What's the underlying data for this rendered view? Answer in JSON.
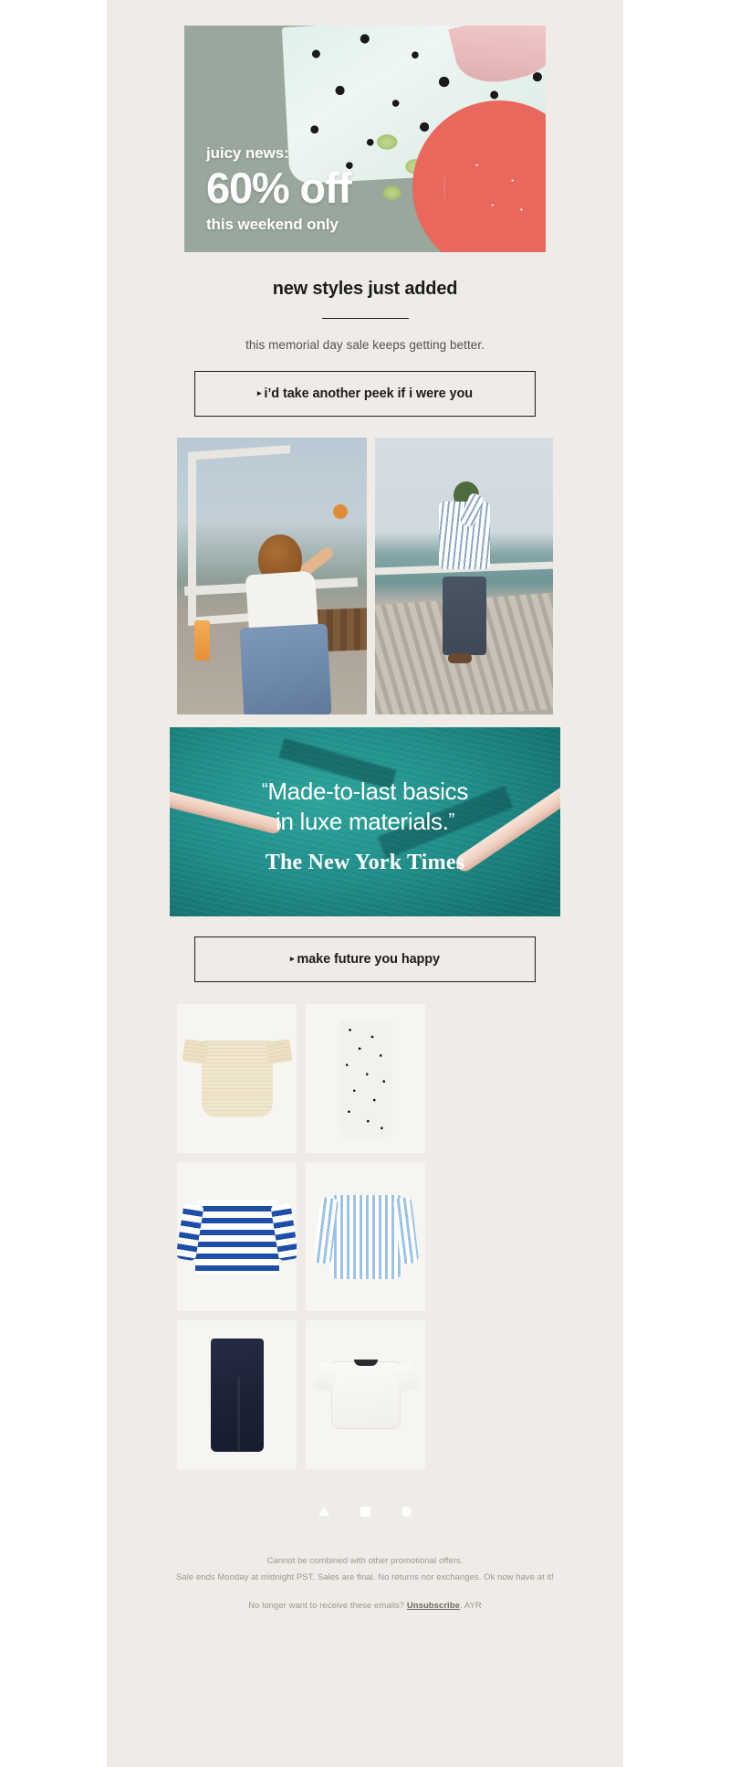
{
  "hero": {
    "eyebrow": "juicy news:",
    "headline": "60% off",
    "sub": "this weekend only",
    "alt": "watermelon-and-polka-dot-cloth-photo"
  },
  "intro": {
    "headline": "new styles just added",
    "subcopy": "this memorial day sale keeps getting better."
  },
  "cta_primary": {
    "marker": "▸",
    "label": "i’d take another peek if i were you"
  },
  "cta_secondary": {
    "marker": "▸",
    "label": "make future you happy"
  },
  "lifestyle": {
    "left_alt": "woman-in-white-shirt-and-jeans-at-beach",
    "right_alt": "person-in-striped-shirt-on-boardwalk"
  },
  "quote": {
    "open_mark": "“",
    "close_mark": "”",
    "line1": "Made-to-last basics",
    "line2": "in luxe materials.",
    "source": "The New York Times",
    "background_alt": "pool-water-with-pink-noodles"
  },
  "products": [
    {
      "name": "cream-short-sleeve-shirt"
    },
    {
      "name": "polka-dot-slip-dress"
    },
    {
      "name": "blue-striped-long-sleeve-top"
    },
    {
      "name": "light-blue-striped-button-down"
    },
    {
      "name": "dark-indigo-straight-jeans"
    },
    {
      "name": "white-short-sleeve-knit-top"
    }
  ],
  "carousel": {
    "indicators": [
      "triangle",
      "square",
      "circle"
    ]
  },
  "footer": {
    "line1": "Cannot be combined with other promotional offers.",
    "line2": "Sale ends Monday at midnight PST. Sales are final. No returns nor exchanges. Ok now have at it!",
    "line3_prefix": "No longer want to receive these emails? ",
    "unsubscribe": "Unsubscribe",
    "line3_suffix": ". AYR"
  },
  "colors": {
    "page_bg": "#efece7",
    "text": "#1d1d1b",
    "muted": "#55534f",
    "footer_text": "#9a958e",
    "quote_teal": "#116e6d"
  }
}
